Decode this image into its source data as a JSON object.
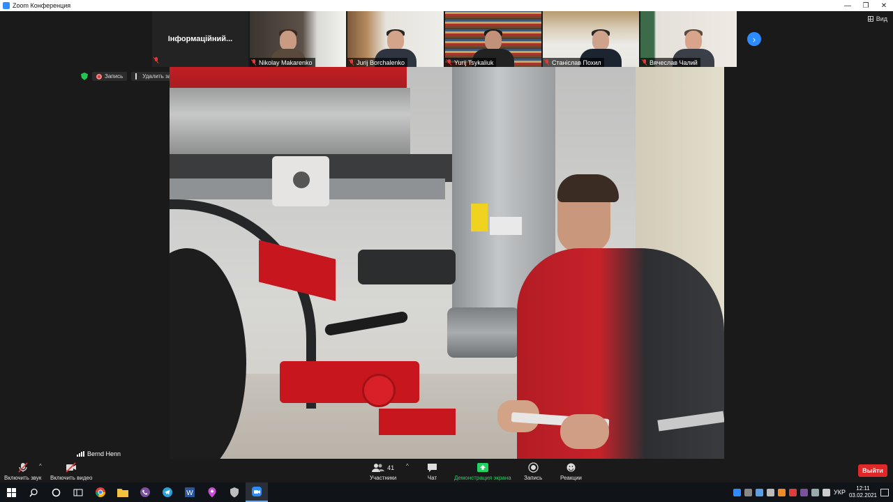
{
  "window": {
    "title": "Zoom Конференция",
    "view_label": "Вид"
  },
  "gallery": {
    "tiles": [
      {
        "name": "Інформаційний...",
        "type": "text"
      },
      {
        "name": "Nikolay Makarenko",
        "muted": true
      },
      {
        "name": "Jurij Borchalenko",
        "muted": true
      },
      {
        "name": "Yurij Tsykaliuk",
        "muted": true
      },
      {
        "name": "Станіслав Похил",
        "muted": true
      },
      {
        "name": "Вячеслав Чалий",
        "muted": true
      }
    ],
    "next_icon": "chevron-right-icon"
  },
  "status": {
    "record_label": "Запись",
    "unpin_label": "Удалить закрепление"
  },
  "active_speaker": {
    "name": "Bernd Henn"
  },
  "toolbar": {
    "audio_label": "Включить звук",
    "video_label": "Включить видео",
    "participants_count": "41",
    "participants_label": "Участники",
    "chat_label": "Чат",
    "share_label": "Демонстрация экрана",
    "record_label": "Запись",
    "reactions_label": "Реакции",
    "leave_label": "Выйти"
  },
  "taskbar": {
    "lang": "УКР",
    "time": "12:11",
    "date": "03.02.2021"
  },
  "colors": {
    "accent": "#2d8cff",
    "share_green": "#23d160",
    "leave_red": "#e02828",
    "mute_red": "#e53935"
  }
}
